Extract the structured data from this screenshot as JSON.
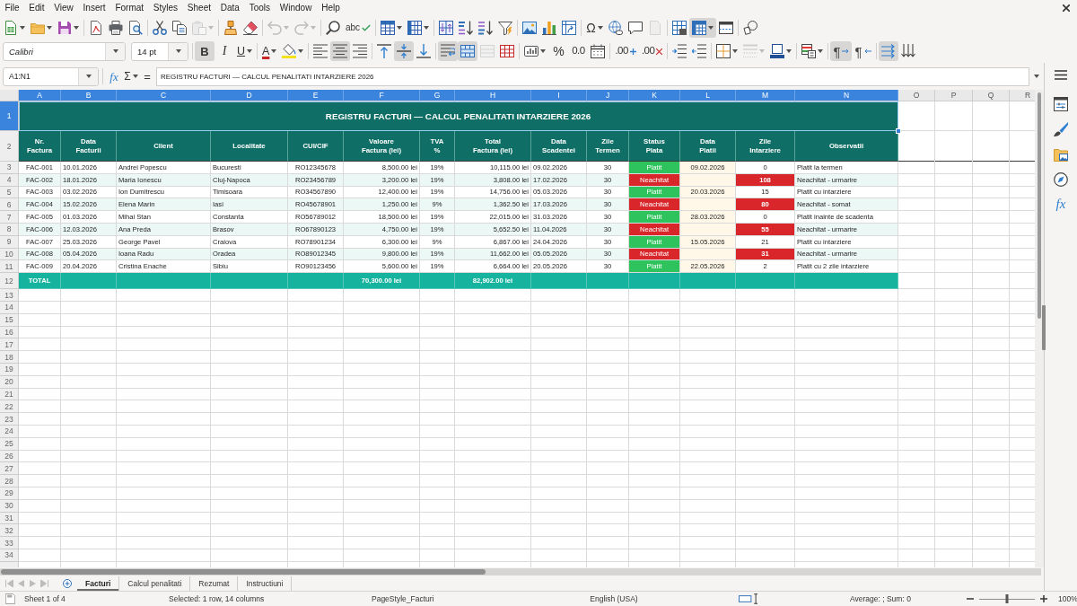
{
  "menu_bar": {
    "items": [
      "File",
      "Edit",
      "View",
      "Insert",
      "Format",
      "Styles",
      "Sheet",
      "Data",
      "Tools",
      "Window",
      "Help"
    ]
  },
  "standard_toolbar": {
    "paste": {
      "enabled": false
    },
    "undo": {
      "enabled": false
    },
    "redo": {
      "enabled": false
    },
    "spelling": {
      "label": "abc"
    },
    "special_character": {
      "label": "Ω"
    },
    "header_footer": {
      "enabled": false
    },
    "freeze_panes": {
      "pressed": true
    }
  },
  "formatting_toolbar": {
    "font_name": "Calibri",
    "font_size": "14 pt",
    "bold": {
      "label": "B",
      "pressed": true
    },
    "italic": {
      "label": "I",
      "pressed": false
    },
    "underline": {
      "label": "U",
      "pressed": false
    },
    "font_color": {
      "label": "A"
    },
    "align_left": {
      "pressed": false
    },
    "align_center": {
      "pressed": true
    },
    "align_right": {
      "pressed": false
    },
    "align_top": {
      "pressed": false
    },
    "align_middle": {
      "pressed": true
    },
    "align_bottom": {
      "pressed": false
    },
    "wrap_text": {
      "pressed": true
    },
    "merge_and_center": {
      "pressed": true
    },
    "merge_cells": {
      "enabled": false
    },
    "percent": {
      "label": "%"
    },
    "number": {
      "label": "0.0"
    },
    "add_decimal": {
      "label": ".00"
    },
    "delete_decimal": {
      "label": ".00"
    },
    "border_style": {
      "enabled": false
    },
    "left_to_right": {
      "label": "¶",
      "pressed": true
    },
    "right_to_left": {
      "label": "¶",
      "pressed": false
    },
    "text_horizontal": {
      "pressed": true
    },
    "text_vertical": {
      "pressed": false
    }
  },
  "formula_bar": {
    "name_box": "A1:N1",
    "function_wizard": "fx",
    "sum": "Σ",
    "formula_button": "=",
    "content": "REGISTRU FACTURI — CALCUL PENALITATI INTARZIERE 2026"
  },
  "sheet": {
    "columns": [
      {
        "label": "A",
        "selected": true
      },
      {
        "label": "B",
        "selected": true
      },
      {
        "label": "C",
        "selected": true
      },
      {
        "label": "D",
        "selected": true
      },
      {
        "label": "E",
        "selected": true
      },
      {
        "label": "F",
        "selected": true
      },
      {
        "label": "G",
        "selected": true
      },
      {
        "label": "H",
        "selected": true
      },
      {
        "label": "I",
        "selected": true
      },
      {
        "label": "J",
        "selected": true
      },
      {
        "label": "K",
        "selected": true
      },
      {
        "label": "L",
        "selected": true
      },
      {
        "label": "M",
        "selected": true
      },
      {
        "label": "N",
        "selected": true
      },
      {
        "label": "O",
        "selected": false
      },
      {
        "label": "P",
        "selected": false
      },
      {
        "label": "Q",
        "selected": false
      },
      {
        "label": "R",
        "selected": false
      }
    ],
    "row_headers": [
      {
        "label": "1",
        "selected": true
      },
      {
        "label": "2",
        "selected": false
      },
      {
        "label": "3",
        "selected": false
      },
      {
        "label": "4",
        "selected": false
      },
      {
        "label": "5",
        "selected": false
      },
      {
        "label": "6",
        "selected": false
      },
      {
        "label": "7",
        "selected": false
      },
      {
        "label": "8",
        "selected": false
      },
      {
        "label": "9",
        "selected": false
      },
      {
        "label": "10",
        "selected": false
      },
      {
        "label": "11",
        "selected": false
      },
      {
        "label": "12",
        "selected": false
      },
      {
        "label": "13",
        "selected": false
      },
      {
        "label": "14",
        "selected": false
      },
      {
        "label": "15",
        "selected": false
      },
      {
        "label": "16",
        "selected": false
      },
      {
        "label": "17",
        "selected": false
      },
      {
        "label": "18",
        "selected": false
      },
      {
        "label": "19",
        "selected": false
      },
      {
        "label": "20",
        "selected": false
      },
      {
        "label": "21",
        "selected": false
      },
      {
        "label": "22",
        "selected": false
      },
      {
        "label": "23",
        "selected": false
      },
      {
        "label": "24",
        "selected": false
      },
      {
        "label": "25",
        "selected": false
      },
      {
        "label": "26",
        "selected": false
      },
      {
        "label": "27",
        "selected": false
      },
      {
        "label": "28",
        "selected": false
      },
      {
        "label": "29",
        "selected": false
      },
      {
        "label": "30",
        "selected": false
      },
      {
        "label": "31",
        "selected": false
      },
      {
        "label": "32",
        "selected": false
      },
      {
        "label": "33",
        "selected": false
      },
      {
        "label": "34",
        "selected": false
      }
    ],
    "title": {
      "text": "REGISTRU FACTURI — CALCUL PENALITATI INTARZIERE 2026",
      "selected": true
    },
    "headers": [
      "Nr.\nFactura",
      "Data\nFacturii",
      "Client",
      "Localitate",
      "CUI/CIF",
      "Valoare\nFactura (lei)",
      "TVA\n%",
      "Total\nFactura (lei)",
      "Data\nScadentei",
      "Zile\nTermen",
      "Status\nPlata",
      "Data\nPlatii",
      "Zile\nIntarziere",
      "Observatii"
    ],
    "rows": [
      {
        "invoice_no": "FAC-001",
        "invoice_date": "10.01.2026",
        "client": "Andrei Popescu",
        "city": "Bucuresti",
        "tax_id": "RO12345678",
        "amount": "8,500.00 lei",
        "vat": "19%",
        "total": "10,115.00 lei",
        "due_date": "09.02.2026",
        "term_days": "30",
        "status": {
          "text": "Platit",
          "color": "#2ec35c"
        },
        "payment_date": "09.02.2026",
        "days_late": {
          "text": "0"
        },
        "notes": "Platit la termen"
      },
      {
        "invoice_no": "FAC-002",
        "invoice_date": "18.01.2026",
        "client": "Maria Ionescu",
        "city": "Cluj-Napoca",
        "tax_id": "RO23456789",
        "amount": "3,200.00 lei",
        "vat": "19%",
        "total": "3,808.00 lei",
        "due_date": "17.02.2026",
        "term_days": "30",
        "status": {
          "text": "Neachitat",
          "color": "#d9262b"
        },
        "days_late": {
          "text": "108",
          "color": "#d9262b"
        },
        "notes": "Neachitat - urmarire"
      },
      {
        "invoice_no": "FAC-003",
        "invoice_date": "03.02.2026",
        "client": "Ion Dumitrescu",
        "city": "Timisoara",
        "tax_id": "RO34567890",
        "amount": "12,400.00 lei",
        "vat": "19%",
        "total": "14,756.00 lei",
        "due_date": "05.03.2026",
        "term_days": "30",
        "status": {
          "text": "Platit",
          "color": "#2ec35c"
        },
        "payment_date": "20.03.2026",
        "days_late": {
          "text": "15"
        },
        "notes": "Platit cu intarziere"
      },
      {
        "invoice_no": "FAC-004",
        "invoice_date": "15.02.2026",
        "client": "Elena Marin",
        "city": "Iasi",
        "tax_id": "RO45678901",
        "amount": "1,250.00 lei",
        "vat": "9%",
        "total": "1,362.50 lei",
        "due_date": "17.03.2026",
        "term_days": "30",
        "status": {
          "text": "Neachitat",
          "color": "#d9262b"
        },
        "days_late": {
          "text": "80",
          "color": "#d9262b"
        },
        "notes": "Neachitat - somat"
      },
      {
        "invoice_no": "FAC-005",
        "invoice_date": "01.03.2026",
        "client": "Mihai Stan",
        "city": "Constanta",
        "tax_id": "RO56789012",
        "amount": "18,500.00 lei",
        "vat": "19%",
        "total": "22,015.00 lei",
        "due_date": "31.03.2026",
        "term_days": "30",
        "status": {
          "text": "Platit",
          "color": "#2ec35c"
        },
        "payment_date": "28.03.2026",
        "days_late": {
          "text": "0"
        },
        "notes": "Platit inainte de scadenta"
      },
      {
        "invoice_no": "FAC-006",
        "invoice_date": "12.03.2026",
        "client": "Ana Preda",
        "city": "Brasov",
        "tax_id": "RO67890123",
        "amount": "4,750.00 lei",
        "vat": "19%",
        "total": "5,652.50 lei",
        "due_date": "11.04.2026",
        "term_days": "30",
        "status": {
          "text": "Neachitat",
          "color": "#d9262b"
        },
        "days_late": {
          "text": "55",
          "color": "#d9262b"
        },
        "notes": "Neachitat - urmarire"
      },
      {
        "invoice_no": "FAC-007",
        "invoice_date": "25.03.2026",
        "client": "George Pavel",
        "city": "Craiova",
        "tax_id": "RO78901234",
        "amount": "6,300.00 lei",
        "vat": "9%",
        "total": "6,867.00 lei",
        "due_date": "24.04.2026",
        "term_days": "30",
        "status": {
          "text": "Platit",
          "color": "#2ec35c"
        },
        "payment_date": "15.05.2026",
        "days_late": {
          "text": "21"
        },
        "notes": "Platit cu intarziere"
      },
      {
        "invoice_no": "FAC-008",
        "invoice_date": "05.04.2026",
        "client": "Ioana Radu",
        "city": "Oradea",
        "tax_id": "RO89012345",
        "amount": "9,800.00 lei",
        "vat": "19%",
        "total": "11,662.00 lei",
        "due_date": "05.05.2026",
        "term_days": "30",
        "status": {
          "text": "Neachitat",
          "color": "#d9262b"
        },
        "days_late": {
          "text": "31",
          "color": "#d9262b"
        },
        "notes": "Neachitat - urmarire"
      },
      {
        "invoice_no": "FAC-009",
        "invoice_date": "20.04.2026",
        "client": "Cristina Enache",
        "city": "Sibiu",
        "tax_id": "RO90123456",
        "amount": "5,600.00 lei",
        "vat": "19%",
        "total": "6,664.00 lei",
        "due_date": "20.05.2026",
        "term_days": "30",
        "status": {
          "text": "Platit",
          "color": "#2ec35c"
        },
        "payment_date": "22.05.2026",
        "days_late": {
          "text": "2"
        },
        "notes": "Platit cu 2 zile intarziere"
      }
    ],
    "total_row": {
      "label": "TOTAL",
      "amount": "70,300.00 lei",
      "total": "82,902.00 lei"
    }
  },
  "sheet_tabs": {
    "navigation_enabled": false,
    "tabs": [
      {
        "label": "Facturi",
        "selected": true
      },
      {
        "label": "Calcul penalitati",
        "selected": false
      },
      {
        "label": "Rezumat",
        "selected": false
      },
      {
        "label": "Instructiuni",
        "selected": false
      }
    ]
  },
  "sidebar": {
    "functions_button": "fx"
  },
  "status_bar": {
    "sheet": "Sheet 1 of 4",
    "selection": "Selected: 1 row, 14 columns",
    "page_style": "PageStyle_Facturi",
    "language": "English (USA)",
    "statistics": "Average: ; Sum: 0",
    "zoom": {
      "label": "100%",
      "level": 0.5
    }
  }
}
